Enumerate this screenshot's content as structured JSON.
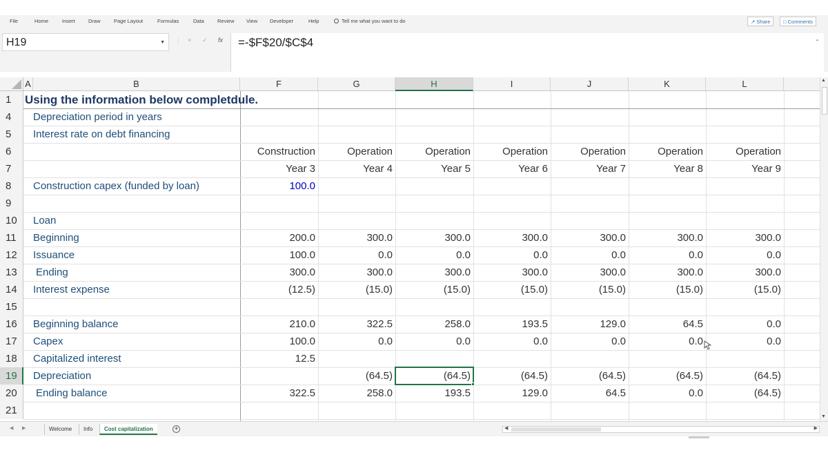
{
  "ribbon": {
    "tabs": [
      "File",
      "Home",
      "Insert",
      "Draw",
      "Page Layout",
      "Formulas",
      "Data",
      "Review",
      "View",
      "Developer",
      "Help"
    ],
    "tell_me": "Tell me what you want to do",
    "share": "Share",
    "comments": "Comments"
  },
  "formula_bar": {
    "name_box": "H19",
    "formula": "=-$F$20/$C$4",
    "fx": "fx",
    "cancel": "×",
    "enter": "✓"
  },
  "columns": [
    "A",
    "B",
    "F",
    "G",
    "H",
    "I",
    "J",
    "K",
    "L"
  ],
  "rows": {
    "r1": {
      "num": "1",
      "title": "Using the information below completdule."
    },
    "r4": {
      "num": "4",
      "label": "Depreciation period in years"
    },
    "r5": {
      "num": "5",
      "label": "Interest rate on debt financing"
    },
    "r6": {
      "num": "6",
      "F": "Construction",
      "G": "Operation",
      "H": "Operation",
      "I": "Operation",
      "J": "Operation",
      "K": "Operation",
      "L": "Operation"
    },
    "r7": {
      "num": "7",
      "F": "Year 3",
      "G": "Year 4",
      "H": "Year 5",
      "I": "Year 6",
      "J": "Year 7",
      "K": "Year 8",
      "L": "Year 9"
    },
    "r8": {
      "num": "8",
      "label": "Construction capex (funded by loan)",
      "F": "100.0"
    },
    "r9": {
      "num": "9"
    },
    "r10": {
      "num": "10",
      "label": "Loan"
    },
    "r11": {
      "num": "11",
      "label": "Beginning",
      "F": "200.0",
      "G": "300.0",
      "H": "300.0",
      "I": "300.0",
      "J": "300.0",
      "K": "300.0",
      "L": "300.0"
    },
    "r12": {
      "num": "12",
      "label": "Issuance",
      "F": "100.0",
      "G": "0.0",
      "H": "0.0",
      "I": "0.0",
      "J": "0.0",
      "K": "0.0",
      "L": "0.0"
    },
    "r13": {
      "num": "13",
      "label": "Ending",
      "F": "300.0",
      "G": "300.0",
      "H": "300.0",
      "I": "300.0",
      "J": "300.0",
      "K": "300.0",
      "L": "300.0"
    },
    "r14": {
      "num": "14",
      "label": "Interest expense",
      "F": "(12.5)",
      "G": "(15.0)",
      "H": "(15.0)",
      "I": "(15.0)",
      "J": "(15.0)",
      "K": "(15.0)",
      "L": "(15.0)"
    },
    "r15": {
      "num": "15"
    },
    "r16": {
      "num": "16",
      "label": "Beginning balance",
      "F": "210.0",
      "G": "322.5",
      "H": "258.0",
      "I": "193.5",
      "J": "129.0",
      "K": "64.5",
      "L": "0.0"
    },
    "r17": {
      "num": "17",
      "label": "Capex",
      "F": "100.0",
      "G": "0.0",
      "H": "0.0",
      "I": "0.0",
      "J": "0.0",
      "K": "0.0",
      "L": "0.0"
    },
    "r18": {
      "num": "18",
      "label": "Capitalized interest",
      "F": "12.5"
    },
    "r19": {
      "num": "19",
      "label": "Depreciation",
      "G": "(64.5)",
      "H": "(64.5)",
      "I": "(64.5)",
      "J": "(64.5)",
      "K": "(64.5)",
      "L": "(64.5)"
    },
    "r20": {
      "num": "20",
      "label": "Ending balance",
      "F": "322.5",
      "G": "258.0",
      "H": "193.5",
      "I": "129.0",
      "J": "64.5",
      "K": "0.0",
      "L": "(64.5)"
    },
    "r21": {
      "num": "21"
    }
  },
  "sheets": [
    "Welcome",
    "Info",
    "Cost capitalization"
  ],
  "active_sheet": "Cost capitalization",
  "active_cell": "H19",
  "colors": {
    "accent": "#217346",
    "label_blue": "#1f4e79",
    "input_blue": "#0000c0"
  }
}
